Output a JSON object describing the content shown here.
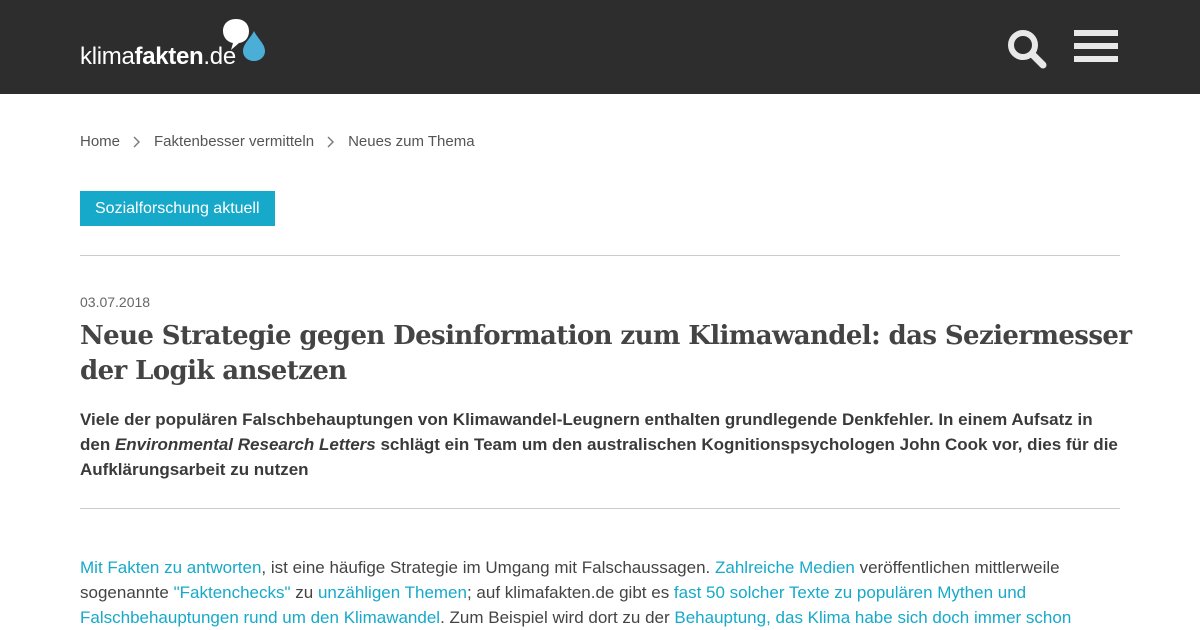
{
  "header": {
    "logo_prefix": "klima",
    "logo_bold": "fakten",
    "logo_suffix": ".de",
    "icons": [
      "speech-bubble-logo-icon",
      "search-icon",
      "hamburger-menu-icon"
    ],
    "background": "#2d2d2d"
  },
  "breadcrumb": {
    "items": [
      "Home",
      "Faktenbesser vermitteln",
      "Neues zum Thema"
    ]
  },
  "category": {
    "label": "Sozialforschung aktuell",
    "color": "#17a9c9"
  },
  "article": {
    "date": "03.07.2018",
    "title": "Neue Strategie gegen Desinformation zum Klimawandel: das Seziermesser der Logik ansetzen",
    "lead_part1": "Viele der populären Falschbehauptungen von Klimawandel-Leugnern enthalten grundlegende Denkfehler. In einem Aufsatz in den ",
    "lead_journal": "Environmental Research Letters",
    "lead_part2": " schlägt ein Team um den australischen Kognitionspsychologen John Cook vor, dies für die Aufklärungsarbeit zu nutzen",
    "body": {
      "link1": "Mit Fakten zu antworten",
      "text1": ", ist eine häufige Strategie im Umgang mit Falschaussagen. ",
      "link2": "Zahlreiche Medien",
      "text2": " veröffentlichen mittlerweile sogenannte ",
      "link3": "\"Faktenchecks\"",
      "text3": "  zu ",
      "link4": "unzähligen Themen",
      "text4": "; auf klimafakten.de gibt es ",
      "link5": "fast 50 solcher Texte zu populären Mythen und Falschbehauptungen rund um den Klimawandel",
      "text5": ". Zum Beispiel wird dort zu der ",
      "link6": "Behauptung, das Klima habe sich doch immer schon"
    },
    "link_color": "#17a9c9"
  }
}
